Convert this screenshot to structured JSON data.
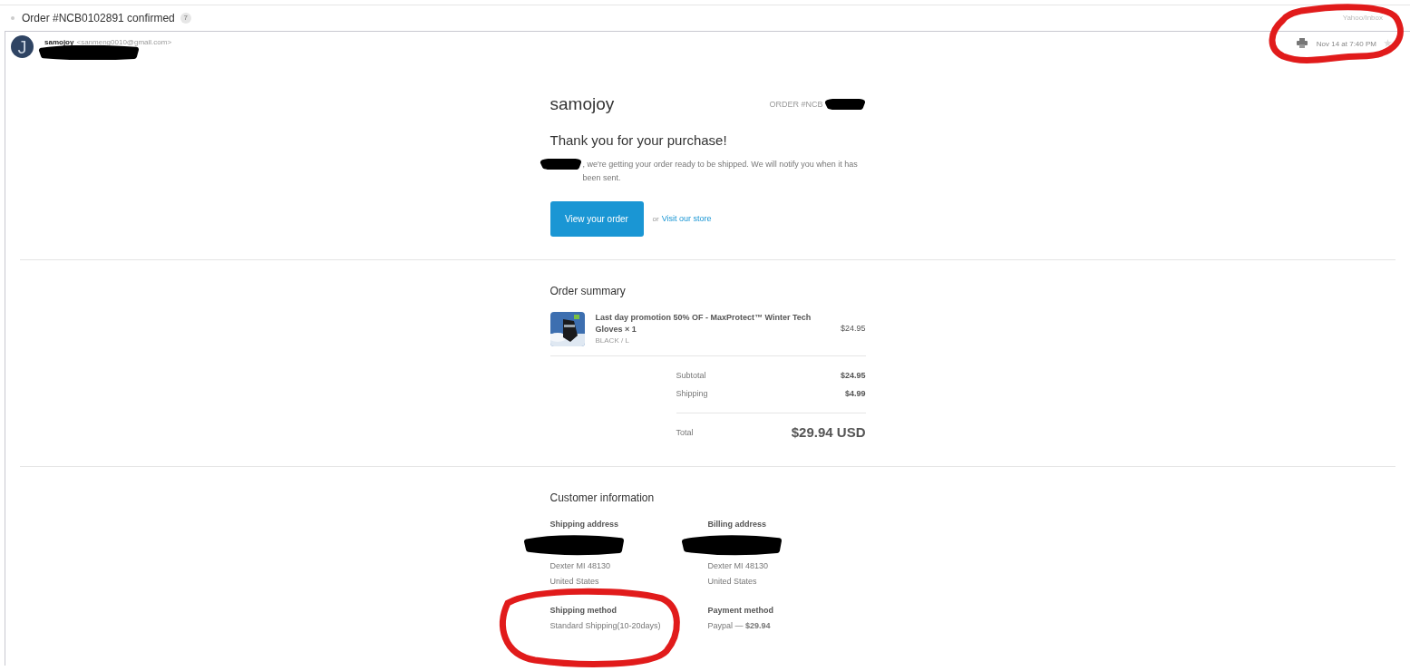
{
  "thread": {
    "subject": "Order #NCB0102891 confirmed",
    "count": "7",
    "folder": "Yahoo/Inbox"
  },
  "message": {
    "avatar_letter": "J",
    "sender": "samojoy",
    "email": "<sanmeng0010@gmail.com>",
    "date": "Nov 14 at 7:40 PM",
    "starred": false
  },
  "shop": {
    "name": "samojoy",
    "order_number": "ORDER #NCB"
  },
  "heading": "Thank you for your purchase!",
  "intro": ", we're getting your order ready to be shipped. We will notify you when it has been sent.",
  "primary_button": "View your order",
  "or_text": "or",
  "store_link": "Visit our store",
  "summary": {
    "title": "Order summary",
    "items": [
      {
        "kind": "picture",
        "name": "Last day promotion 50% OF - MaxProtect™ Winter Tech Gloves × 1",
        "variant": "BLACK / L",
        "price": "$24.95"
      }
    ],
    "lines": [
      {
        "label": "Subtotal",
        "value": "$24.95"
      },
      {
        "label": "Shipping",
        "value": "$4.99"
      }
    ],
    "total": {
      "label": "Total",
      "value": "$29.94 USD"
    }
  },
  "customer": {
    "title": "Customer information",
    "blocks": [
      {
        "title": "Shipping address",
        "redacted": true,
        "lines": [
          "Dexter MI 48130",
          "United States"
        ]
      },
      {
        "title": "Billing address",
        "redacted": true,
        "lines": [
          "Dexter MI 48130",
          "United States"
        ]
      },
      {
        "title": "Shipping method",
        "redacted": false,
        "lines": [
          "Standard Shipping(10-20days)"
        ]
      },
      {
        "title": "Payment method",
        "redacted": false,
        "lines": [
          "Paypal — **$29.94**"
        ]
      }
    ]
  }
}
